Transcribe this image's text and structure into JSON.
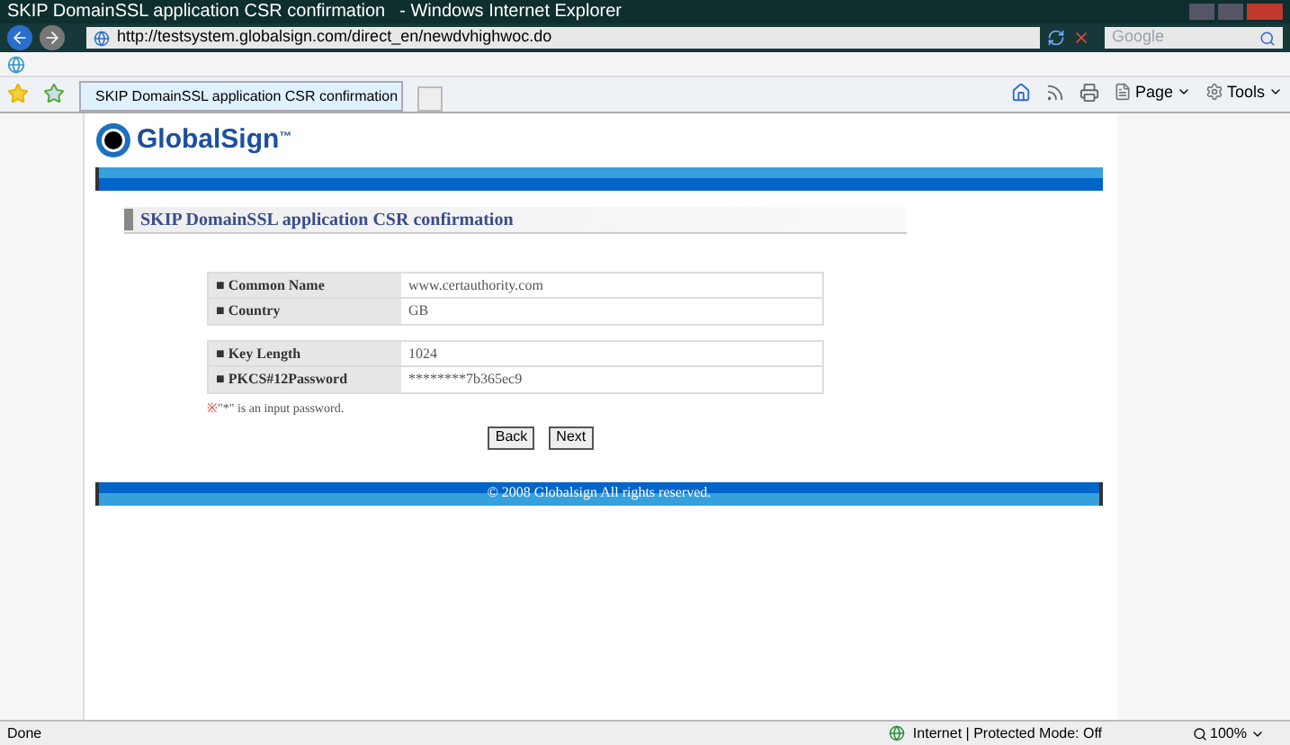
{
  "window": {
    "title": "SKIP DomainSSL application CSR confirmation",
    "app": "- Windows Internet Explorer"
  },
  "address_bar": {
    "url": "http://testsystem.globalsign.com/direct_en/newdvhighwoc.do"
  },
  "search": {
    "placeholder": "Google"
  },
  "tabs": [
    {
      "label": "SKIP DomainSSL application CSR confirmation",
      "selected": true
    }
  ],
  "command_bar": [
    "Page",
    "Tools"
  ],
  "page": {
    "logo": "GlobalSign",
    "logo_mark": "™",
    "heading": "SKIP DomainSSL application CSR confirmation",
    "tables": [
      [
        {
          "label": "■ Common Name",
          "value": "www.certauthority.com"
        },
        {
          "label": "■ Country",
          "value": "GB"
        }
      ],
      [
        {
          "label": "■ Key Length",
          "value": "1024"
        },
        {
          "label": "■ PKCS#12Password",
          "value": "********7b365ec9"
        }
      ]
    ],
    "note_mark": "※",
    "note": "\"*\" is an input password.",
    "buttons": [
      "Back",
      "Next"
    ],
    "footer": "© 2008 Globalsign All rights reserved."
  },
  "status_bar": {
    "text": "Done",
    "zone": "Internet | Protected Mode: Off",
    "zoom": "100%"
  }
}
